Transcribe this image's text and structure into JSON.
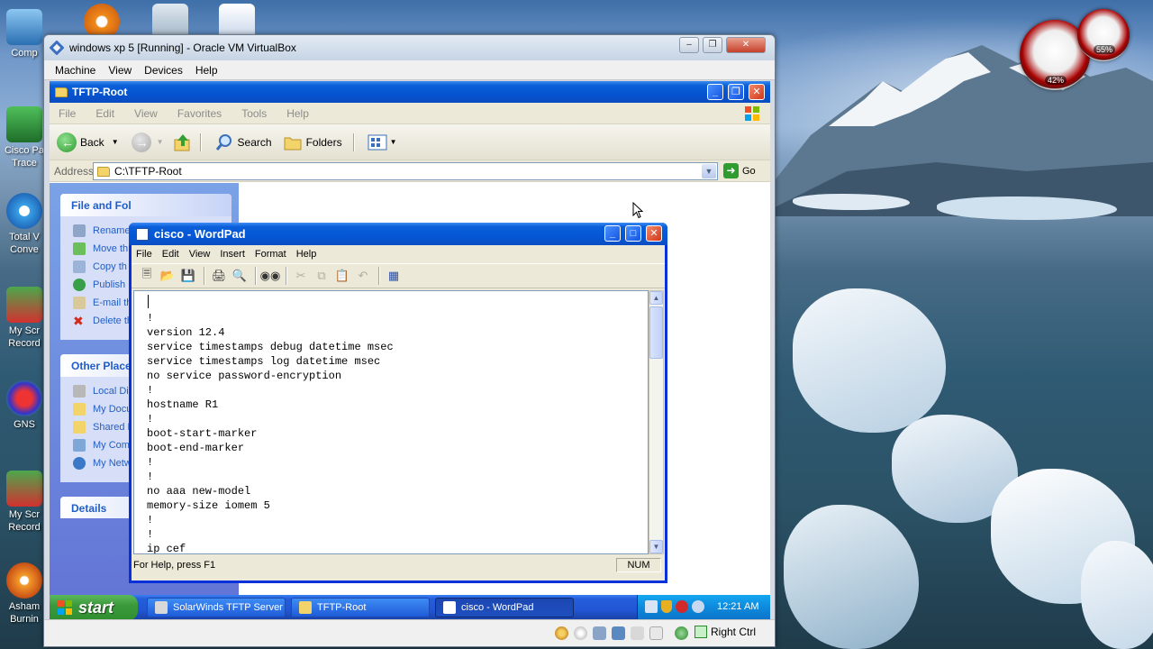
{
  "host": {
    "desktop_icons": [
      "Comp",
      "Cisco Pa Trace",
      "Total V Conve",
      "My Scr Record",
      "GNS",
      "My Scr Record",
      "Asham Burnin"
    ],
    "gauges": [
      {
        "value": "42%"
      },
      {
        "value": "55%"
      }
    ]
  },
  "vbox": {
    "title": "windows xp 5 [Running] - Oracle VM VirtualBox",
    "menu": [
      "Machine",
      "View",
      "Devices",
      "Help"
    ],
    "host_key": "Right Ctrl"
  },
  "explorer": {
    "title": "TFTP-Root",
    "menu": [
      "File",
      "Edit",
      "View",
      "Favorites",
      "Tools",
      "Help"
    ],
    "toolbar": {
      "back": "Back",
      "search": "Search",
      "folders": "Folders"
    },
    "address_label": "Address",
    "address_value": "C:\\TFTP-Root",
    "go_label": "Go",
    "file_tasks": {
      "title": "File and Fol",
      "items": [
        "Rename",
        "Move th",
        "Copy th",
        "Publish",
        "E-mail th",
        "Delete th"
      ]
    },
    "other_places": {
      "title": "Other Place",
      "items": [
        "Local Dis",
        "My Docu",
        "Shared D",
        "My Comp",
        "My Netw"
      ]
    },
    "details": {
      "title": "Details"
    }
  },
  "wordpad": {
    "title": "cisco - WordPad",
    "menu": [
      "File",
      "Edit",
      "View",
      "Insert",
      "Format",
      "Help"
    ],
    "lines": [
      "",
      "!",
      "version 12.4",
      "service timestamps debug datetime msec",
      "service timestamps log datetime msec",
      "no service password-encryption",
      "!",
      "hostname R1",
      "!",
      "boot-start-marker",
      "boot-end-marker",
      "!",
      "!",
      "no aaa new-model",
      "memory-size iomem 5",
      "!",
      "!",
      "ip cef"
    ],
    "status_help": "For Help, press F1",
    "status_num": "NUM"
  },
  "taskbar": {
    "start_label": "start",
    "tasks": [
      "SolarWinds TFTP Server",
      "TFTP-Root",
      "cisco - WordPad"
    ],
    "clock": "12:21 AM"
  },
  "colors": {
    "xp_blue": "#0a5fd8",
    "start_green": "#3c9a3c",
    "task_link": "#215dc6"
  }
}
